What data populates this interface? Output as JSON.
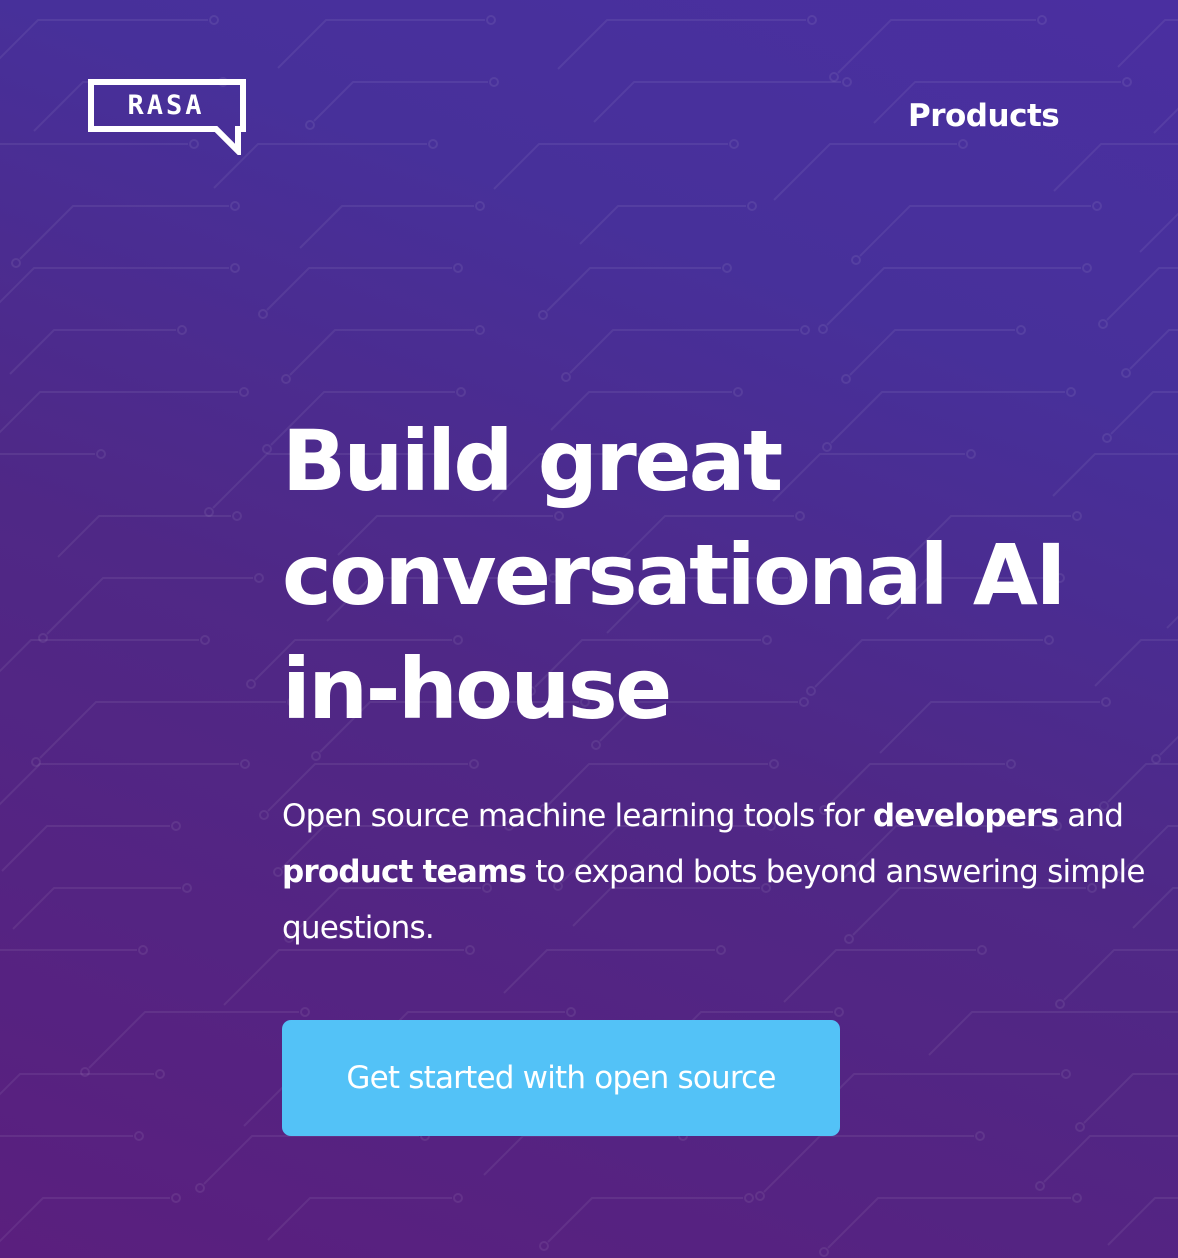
{
  "header": {
    "logo_text": "RASA",
    "nav_products": "Products"
  },
  "hero": {
    "headline_lines": [
      "Build great",
      "conversational AI",
      "in-house"
    ],
    "subtitle": {
      "part1": "Open source machine learning tools for ",
      "bold1": "developers",
      "part2": " and ",
      "bold2": "product teams",
      "part3": " to expand bots beyond answering simple questions."
    },
    "cta_label": "Get started with open source"
  },
  "colors": {
    "background_start": "#5a1f7e",
    "background_end": "#4a2fa0",
    "cta": "#53c2f7",
    "text": "#ffffff"
  }
}
